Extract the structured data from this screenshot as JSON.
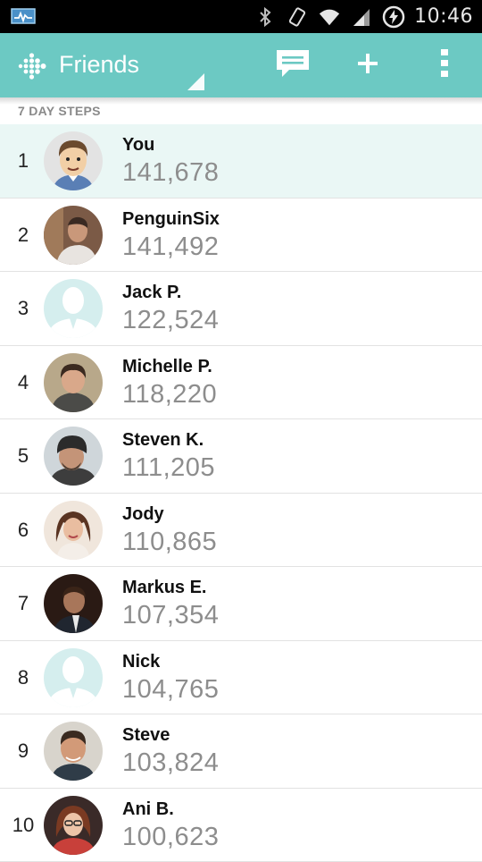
{
  "status_bar": {
    "time": "10:46",
    "icons": [
      "notification-icon",
      "bluetooth-icon",
      "vibrate-icon",
      "wifi-icon",
      "signal-icon",
      "sync-icon"
    ]
  },
  "app_bar": {
    "title": "Friends",
    "accent_color": "#6cc9c3",
    "actions": [
      "message-icon",
      "add-icon",
      "overflow-menu-icon"
    ]
  },
  "section": {
    "header": "7 DAY STEPS"
  },
  "leaderboard": [
    {
      "rank": "1",
      "name": "You",
      "steps": "141,678",
      "avatar": "cartoon-avatar",
      "highlight": true
    },
    {
      "rank": "2",
      "name": "PenguinSix",
      "steps": "141,492",
      "avatar": "photo-avatar"
    },
    {
      "rank": "3",
      "name": "Jack P.",
      "steps": "122,524",
      "avatar": "default-avatar"
    },
    {
      "rank": "4",
      "name": "Michelle P.",
      "steps": "118,220",
      "avatar": "photo-avatar"
    },
    {
      "rank": "5",
      "name": "Steven K.",
      "steps": "111,205",
      "avatar": "photo-avatar"
    },
    {
      "rank": "6",
      "name": "Jody",
      "steps": "110,865",
      "avatar": "photo-avatar"
    },
    {
      "rank": "7",
      "name": "Markus E.",
      "steps": "107,354",
      "avatar": "photo-avatar"
    },
    {
      "rank": "8",
      "name": "Nick",
      "steps": "104,765",
      "avatar": "default-avatar"
    },
    {
      "rank": "9",
      "name": "Steve",
      "steps": "103,824",
      "avatar": "photo-avatar"
    },
    {
      "rank": "10",
      "name": "Ani B.",
      "steps": "100,623",
      "avatar": "photo-avatar"
    }
  ]
}
